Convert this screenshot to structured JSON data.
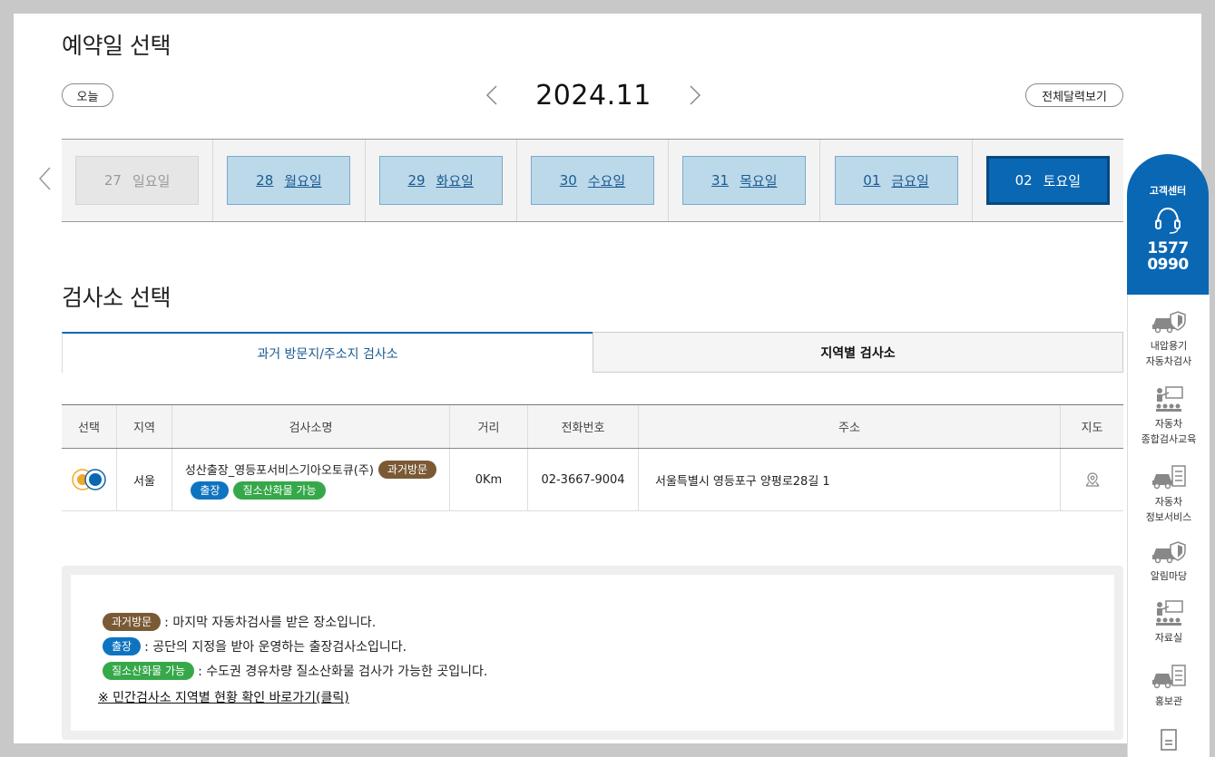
{
  "reservation": {
    "title": "예약일 선택",
    "today_label": "오늘",
    "month_label": "2024.11",
    "full_calendar_label": "전체달력보기",
    "days": [
      {
        "date": "27",
        "day": "일요일",
        "state": "disabled"
      },
      {
        "date": "28",
        "day": "월요일",
        "state": "normal"
      },
      {
        "date": "29",
        "day": "화요일",
        "state": "normal"
      },
      {
        "date": "30",
        "day": "수요일",
        "state": "normal"
      },
      {
        "date": "31",
        "day": "목요일",
        "state": "normal"
      },
      {
        "date": "01",
        "day": "금요일",
        "state": "normal"
      },
      {
        "date": "02",
        "day": "토요일",
        "state": "selected"
      }
    ]
  },
  "station": {
    "title": "검사소 선택",
    "tabs": [
      {
        "label": "과거 방문지/주소지 검사소",
        "active": true
      },
      {
        "label": "지역별 검사소",
        "active": false
      }
    ],
    "columns": [
      "선택",
      "지역",
      "검사소명",
      "거리",
      "전화번호",
      "주소",
      "지도"
    ],
    "rows": [
      {
        "region": "서울",
        "name": "성산출장_영등포서비스기아오토큐(주)",
        "badges": {
          "past": "과거방문",
          "trip": "출장",
          "smoke": "질소산화물 가능"
        },
        "distance": "0Km",
        "phone": "02-3667-9004",
        "address": "서울특별시 영등포구 양평로28길 1"
      }
    ]
  },
  "legend": {
    "items": [
      {
        "badge": "과거방문",
        "text": ": 마지막 자동차검사를 받은 장소입니다."
      },
      {
        "badge": "출장",
        "text": ": 공단의 지정을 받아 운영하는 출장검사소입니다."
      },
      {
        "badge": "질소산화물 가능",
        "text": ": 수도권 경유차량 질소산화물 검사가 가능한 곳입니다."
      }
    ],
    "link": "※ 민간검사소 지역별 현황 확인 바로가기(클릭)"
  },
  "sidebar": {
    "cs_title": "고객센터",
    "cs_phone_1": "1577",
    "cs_phone_2": "0990",
    "items": [
      {
        "line1": "내압용기",
        "line2": "자동차검사",
        "icon": "car-shield-icon"
      },
      {
        "line1": "자동차",
        "line2": "종합검사교육",
        "icon": "classroom-icon"
      },
      {
        "line1": "자동차",
        "line2": "정보서비스",
        "icon": "car-document-icon"
      },
      {
        "line1": "알림마당",
        "line2": "",
        "icon": "car-shield-icon"
      },
      {
        "line1": "자료실",
        "line2": "",
        "icon": "classroom-icon"
      },
      {
        "line1": "홍보관",
        "line2": "",
        "icon": "car-document-icon"
      }
    ]
  },
  "colors": {
    "primary": "#0a67b3",
    "date_normal_bg": "#bcd9ea",
    "badge_past": "#7a5a35",
    "badge_trip": "#0f74c0",
    "badge_smoke": "#36a84a"
  }
}
